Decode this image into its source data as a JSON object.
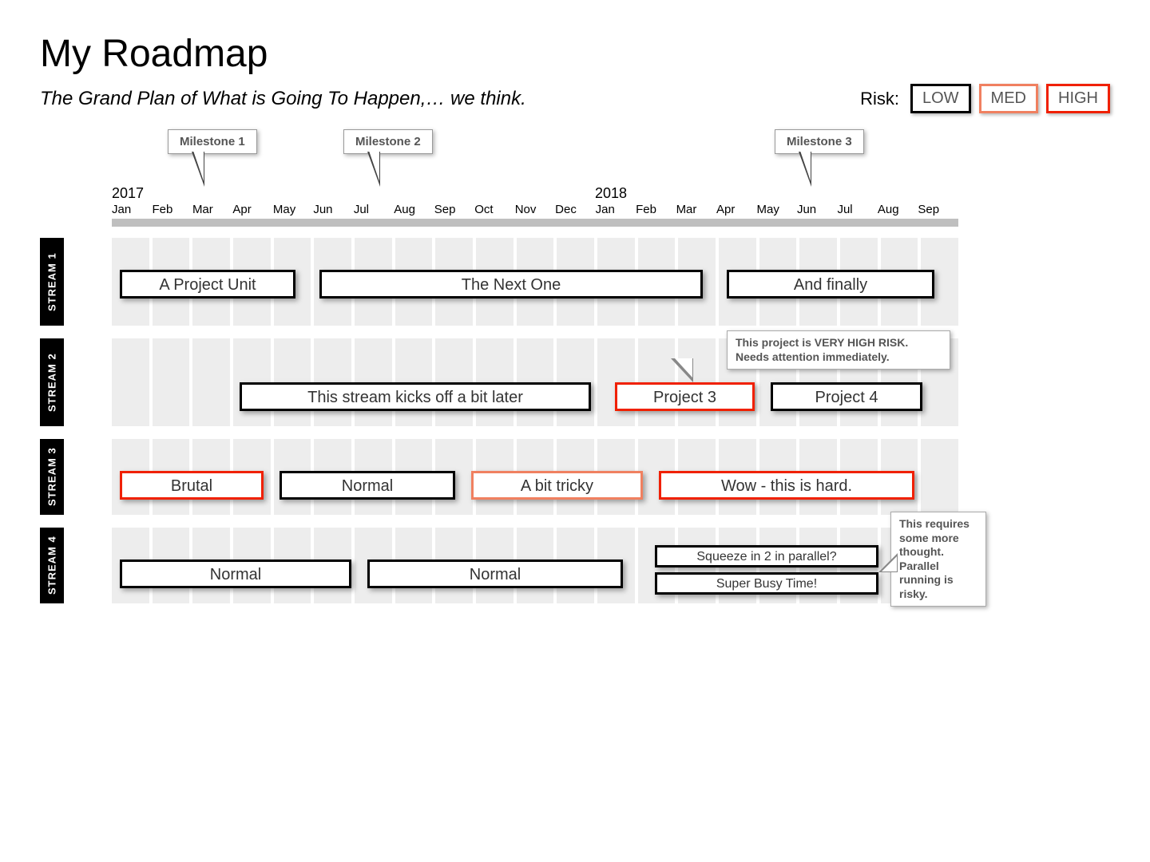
{
  "title": "My Roadmap",
  "subtitle": "The Grand Plan of What is Going To Happen,… we think.",
  "legend": {
    "label": "Risk:",
    "low": "LOW",
    "med": "MED",
    "high": "HIGH"
  },
  "timeline": {
    "years": {
      "y2017": "2017",
      "y2018": "2018"
    },
    "months": [
      "Jan",
      "Feb",
      "Mar",
      "Apr",
      "May",
      "Jun",
      "Jul",
      "Aug",
      "Sep",
      "Oct",
      "Nov",
      "Dec",
      "Jan",
      "Feb",
      "Mar",
      "Apr",
      "May",
      "Jun",
      "Jul",
      "Aug",
      "Sep"
    ]
  },
  "milestones": {
    "m1": "Milestone 1",
    "m2": "Milestone 2",
    "m3": "Milestone 3"
  },
  "streams": {
    "s1": {
      "label": "STREAM 1",
      "p1": "A Project Unit",
      "p2": "The Next One",
      "p3": "And finally"
    },
    "s2": {
      "label": "STREAM 2",
      "p1": "This stream kicks off a bit later",
      "p2": "Project 3",
      "p3": "Project 4",
      "note": "This project is VERY HIGH RISK. Needs attention immediately."
    },
    "s3": {
      "label": "STREAM 3",
      "p1": "Brutal",
      "p2": "Normal",
      "p3": "A bit tricky",
      "p4": "Wow - this is hard."
    },
    "s4": {
      "label": "STREAM 4",
      "p1": "Normal",
      "p2": "Normal",
      "p3": "Squeeze in 2 in parallel?",
      "p4": "Super Busy Time!",
      "note": "This requires some more thought. Parallel running is risky."
    }
  },
  "chart_data": {
    "type": "timeline",
    "title": "My Roadmap",
    "subtitle": "The Grand Plan of What is Going To Happen,… we think.",
    "time_axis": {
      "start": "2017-01",
      "end": "2018-09",
      "unit": "month"
    },
    "risk_levels": [
      "LOW",
      "MED",
      "HIGH"
    ],
    "milestones": [
      {
        "name": "Milestone 1",
        "at": "2017-03"
      },
      {
        "name": "Milestone 2",
        "at": "2017-07"
      },
      {
        "name": "Milestone 3",
        "at": "2018-05"
      }
    ],
    "streams": [
      {
        "name": "STREAM 1",
        "projects": [
          {
            "name": "A Project Unit",
            "start": "2017-01",
            "end": "2017-05",
            "risk": "LOW"
          },
          {
            "name": "The Next One",
            "start": "2017-06",
            "end": "2018-02",
            "risk": "LOW"
          },
          {
            "name": "And finally",
            "start": "2018-03",
            "end": "2018-08",
            "risk": "LOW"
          }
        ]
      },
      {
        "name": "STREAM 2",
        "projects": [
          {
            "name": "This stream kicks off a bit later",
            "start": "2017-04",
            "end": "2017-12",
            "risk": "LOW"
          },
          {
            "name": "Project 3",
            "start": "2018-01",
            "end": "2018-04",
            "risk": "HIGH",
            "note": "This project is VERY HIGH RISK. Needs attention immediately."
          },
          {
            "name": "Project 4",
            "start": "2018-05",
            "end": "2018-08",
            "risk": "LOW"
          }
        ]
      },
      {
        "name": "STREAM 3",
        "projects": [
          {
            "name": "Brutal",
            "start": "2017-01",
            "end": "2017-04",
            "risk": "HIGH"
          },
          {
            "name": "Normal",
            "start": "2017-05",
            "end": "2017-08",
            "risk": "LOW"
          },
          {
            "name": "A bit tricky",
            "start": "2017-09",
            "end": "2018-01",
            "risk": "MED"
          },
          {
            "name": "Wow - this is hard.",
            "start": "2018-02",
            "end": "2018-08",
            "risk": "HIGH"
          }
        ]
      },
      {
        "name": "STREAM 4",
        "projects": [
          {
            "name": "Normal",
            "start": "2017-01",
            "end": "2017-06",
            "risk": "LOW"
          },
          {
            "name": "Normal",
            "start": "2017-07",
            "end": "2018-01",
            "risk": "LOW"
          },
          {
            "name": "Squeeze in 2 in parallel?",
            "start": "2018-02",
            "end": "2018-08",
            "risk": "LOW",
            "lane": 0
          },
          {
            "name": "Super Busy Time!",
            "start": "2018-02",
            "end": "2018-08",
            "risk": "LOW",
            "lane": 1,
            "note": "This requires some more thought. Parallel running is risky."
          }
        ]
      }
    ]
  }
}
